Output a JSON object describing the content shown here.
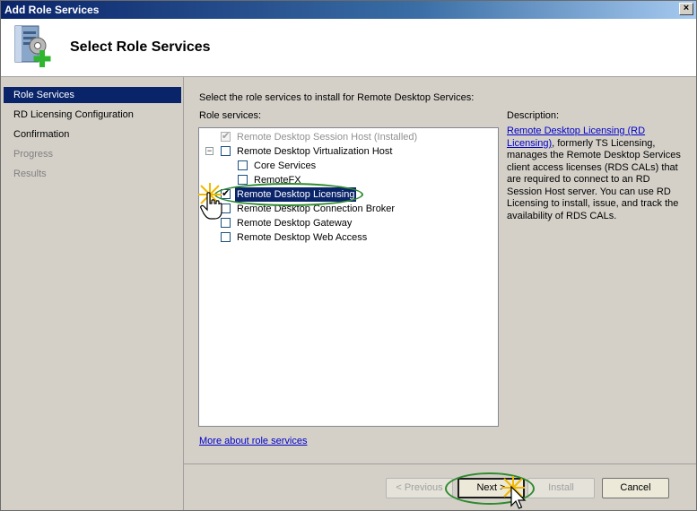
{
  "window": {
    "title": "Add Role Services",
    "close_glyph": "×"
  },
  "header": {
    "title": "Select Role Services",
    "icon": "server-add-icon"
  },
  "sidebar": {
    "items": [
      {
        "label": "Role Services",
        "state": "active"
      },
      {
        "label": "RD Licensing Configuration",
        "state": "normal"
      },
      {
        "label": "Confirmation",
        "state": "normal"
      },
      {
        "label": "Progress",
        "state": "disabled"
      },
      {
        "label": "Results",
        "state": "disabled"
      }
    ]
  },
  "main": {
    "instruction": "Select the role services to install for Remote Desktop Services:",
    "role_services_label": "Role services:",
    "tree": [
      {
        "label": "Remote Desktop Session Host",
        "suffix": "(Installed)",
        "checked": true,
        "disabled": true
      },
      {
        "label": "Remote Desktop Virtualization Host",
        "checked": false,
        "expander": "−"
      },
      {
        "label": "Core Services",
        "checked": false
      },
      {
        "label": "RemoteFX",
        "checked": false
      },
      {
        "label": "Remote Desktop Licensing",
        "checked": true,
        "selected": true
      },
      {
        "label": "Remote Desktop Connection Broker",
        "checked": false
      },
      {
        "label": "Remote Desktop Gateway",
        "checked": false
      },
      {
        "label": "Remote Desktop Web Access",
        "checked": false
      }
    ],
    "more_link": "More about role services"
  },
  "description": {
    "label": "Description:",
    "link": "Remote Desktop Licensing (RD Licensing)",
    "text": ", formerly TS Licensing, manages the Remote Desktop Services client access licenses (RDS CALs) that are required to connect to an RD Session Host server. You can use RD Licensing to install, issue, and track the availability of RDS CALs."
  },
  "footer": {
    "previous": "< Previous",
    "next": "Next >",
    "install": "Install",
    "cancel": "Cancel"
  },
  "colors": {
    "highlight": "#2e8b2e",
    "selection": "#0a246a",
    "link": "#0000cc"
  }
}
